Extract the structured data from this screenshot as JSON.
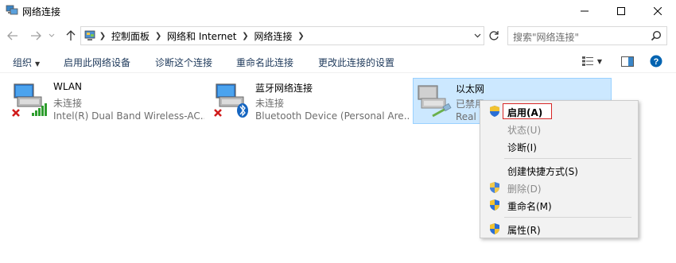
{
  "window": {
    "title": "网络连接"
  },
  "nav": {
    "breadcrumbs": [
      "控制面板",
      "网络和 Internet",
      "网络连接"
    ],
    "search_placeholder": "搜索\"网络连接\""
  },
  "toolbar": {
    "organize": "组织",
    "enable_device": "启用此网络设备",
    "diagnose": "诊断这个连接",
    "rename": "重命名此连接",
    "change_settings": "更改此连接的设置"
  },
  "connections": [
    {
      "name": "WLAN",
      "status": "未连接",
      "device": "Intel(R) Dual Band Wireless-AC..."
    },
    {
      "name": "蓝牙网络连接",
      "status": "未连接",
      "device": "Bluetooth Device (Personal Are..."
    },
    {
      "name": "以太网",
      "status": "已禁用",
      "device": "Real"
    }
  ],
  "context_menu": {
    "enable": "启用(A)",
    "status": "状态(U)",
    "diagnose": "诊断(I)",
    "create_shortcut": "创建快捷方式(S)",
    "delete": "删除(D)",
    "rename": "重命名(M)",
    "properties": "属性(R)"
  },
  "colors": {
    "accent": "#0078d7",
    "selection_bg": "#cce8ff",
    "focus_border": "#d72525"
  }
}
